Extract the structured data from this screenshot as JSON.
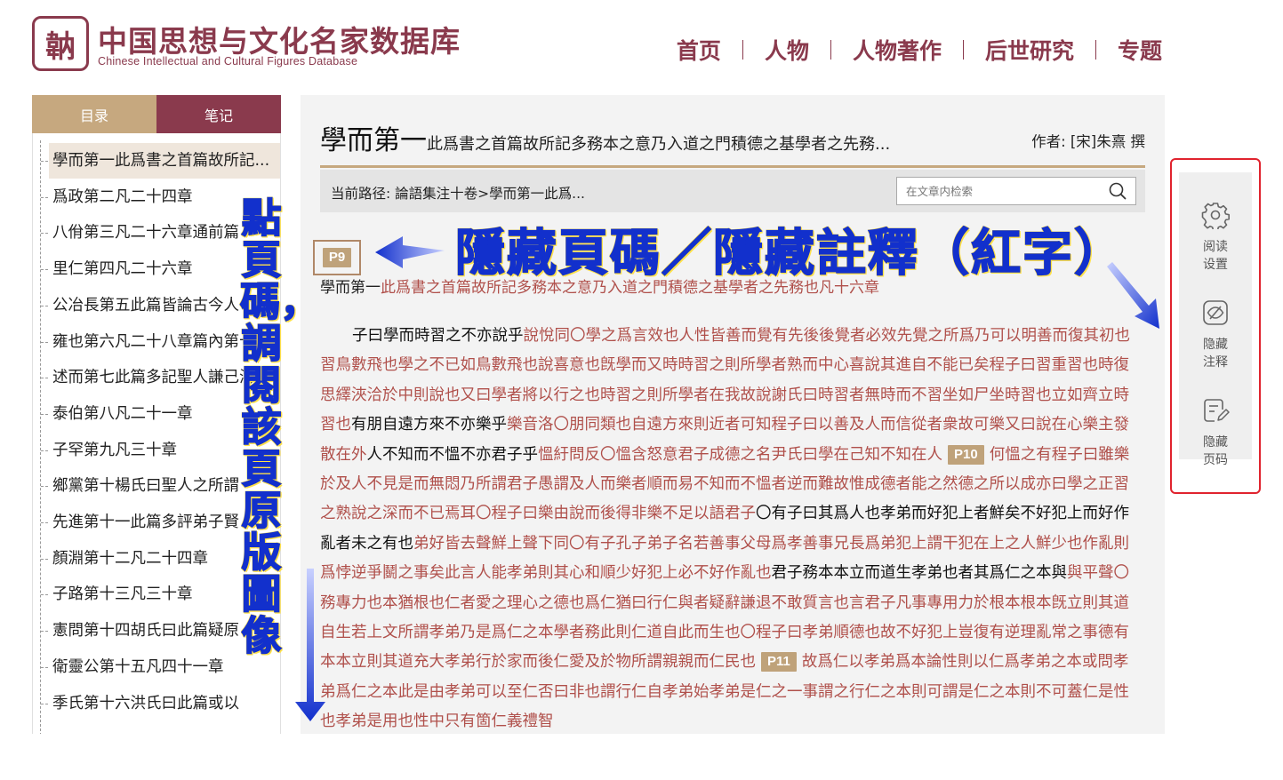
{
  "header": {
    "logo_seal": "䪏",
    "logo_cn": "中国思想与文化名家数据库",
    "logo_en": "Chinese Intellectual and Cultural Figures Database",
    "nav": [
      "首页",
      "人物",
      "人物著作",
      "后世研究",
      "专题"
    ]
  },
  "left_panel": {
    "tabs": [
      "目录",
      "笔记"
    ],
    "toc": [
      "學而第一此爲書之首篇故所記...",
      "爲政第二凡二十四章",
      "八佾第三凡二十六章通前篇",
      "里仁第四凡二十六章",
      "公冶長第五此篇皆論古今人",
      "雍也第六凡二十八章篇內第十,",
      "述而第七此篇多記聖人謙己海",
      "泰伯第八凡二十一章",
      "子罕第九凡三十章",
      "鄉黨第十楊氏曰聖人之所謂",
      "先進第十一此篇多評弟子賢",
      "顏淵第十二凡二十四章",
      "子路第十三凡三十章",
      "憲問第十四胡氏曰此篇疑原",
      "衛靈公第十五凡四十一章",
      "季氏第十六洪氏曰此篇或以"
    ]
  },
  "main": {
    "title_big": "學而第一",
    "title_sub": "此爲書之首篇故所記多務本之意乃入道之門積德之基學者之先務...",
    "author": "作者: [宋]朱熹 撰",
    "path": "当前路径: 論語集注十卷>學而第一此爲...",
    "search_placeholder": "在文章内检索",
    "page_labels": [
      "P9",
      "P10",
      "P11"
    ],
    "intro_black": "學而第一",
    "intro_red": "此爲書之首篇故所記多務本之意乃入道之門積德之基學者之先務也凡十六章",
    "segments": [
      {
        "t": "子曰學而時習之不亦說乎",
        "red": false
      },
      {
        "t": "說悅同〇學之爲言效也人性皆善而覺有先後後覺者必效先覺之所爲乃可以明善而復其初也習鳥數飛也學之不已如鳥數飛也說喜意也旣學而又時時習之則所學者熟而中心喜說其進自不能已矣程子曰習重習也時復思繹浹洽於中則說也又曰學者將以行之也時習之則所學者在我故說謝氏曰時習者無時而不習坐如尸坐時習也立如齊立時習也",
        "red": true
      },
      {
        "t": "有朋自遠方來不亦樂乎",
        "red": false
      },
      {
        "t": "樂音洛〇朋同類也自遠方來則近者可知程子曰以善及人而信從者衆故可樂又曰說在心樂主發散在外",
        "red": true
      },
      {
        "t": "人不知而不慍不亦君子乎",
        "red": false
      },
      {
        "t": "慍紆問反〇慍含怒意君子成德之名尹氏曰學在己知不知在人",
        "red": true
      },
      {
        "t": "P10",
        "page": true
      },
      {
        "t": "何慍之有程子曰雖樂於及人不見是而無悶乃所謂君子愚謂及人而樂者順而易不知而不慍者逆而難故惟成德者能之然德之所以成亦曰學之正習之熟說之深而不已焉耳〇程子曰樂由說而後得非樂不足以語君子",
        "red": true
      },
      {
        "t": "〇有子曰其爲人也孝弟而好犯上者鮮矣不好犯上而好作亂者未之有也",
        "red": false
      },
      {
        "t": "弟好皆去聲鮮上聲下同〇有子孔子弟子名若善事父母爲孝善事兄長爲弟犯上謂干犯在上之人鮮少也作亂則爲悖逆爭鬭之事矣此言人能孝弟則其心和順少好犯上必不好作亂也",
        "red": true
      },
      {
        "t": "君子務本本立而道生孝弟也者其爲仁之本與",
        "red": false
      },
      {
        "t": "與平聲〇務專力也本猶根也仁者愛之理心之德也爲仁猶曰行仁與者疑辭謙退不敢質言也言君子凡事專用力於根本根本旣立則其道自生若上文所謂孝弟乃是爲仁之本學者務此則仁道自此而生也〇程子曰孝弟順德也故不好犯上豈復有逆理亂常之事德有本本立則其道充大孝弟行於家而後仁愛及於物所謂親親而仁民也",
        "red": true
      },
      {
        "t": "P11",
        "page": true
      },
      {
        "t": "故爲仁以孝弟爲本論性則以仁爲孝弟之本或問孝弟爲仁之本此是由孝弟可以至仁否曰非也謂行仁自孝弟始孝弟是仁之一事謂之行仁之本則可謂是仁之本則不可蓋仁是性也孝弟是用也性中只有箇仁義禮智",
        "red": true
      }
    ]
  },
  "toolbar": {
    "buttons": [
      {
        "label1": "阅读",
        "label2": "设置",
        "icon": "gear-icon"
      },
      {
        "label1": "隐藏",
        "label2": "注释",
        "icon": "eye-slash-icon"
      },
      {
        "label1": "隐藏",
        "label2": "页码",
        "icon": "edit-doc-icon"
      }
    ]
  },
  "annotations": {
    "top": "隱藏頁碼／隱藏註釋（紅字）",
    "vertical": "點頁碼，調閱該頁原版圖像"
  },
  "colors": {
    "brand": "#8a3a4d",
    "gold": "#c6a87f",
    "annotation_red": "#b0504b",
    "frame_red": "#e0232e",
    "annotation_blue": "#1230cc",
    "annotation_yellow": "#ffe14a"
  }
}
